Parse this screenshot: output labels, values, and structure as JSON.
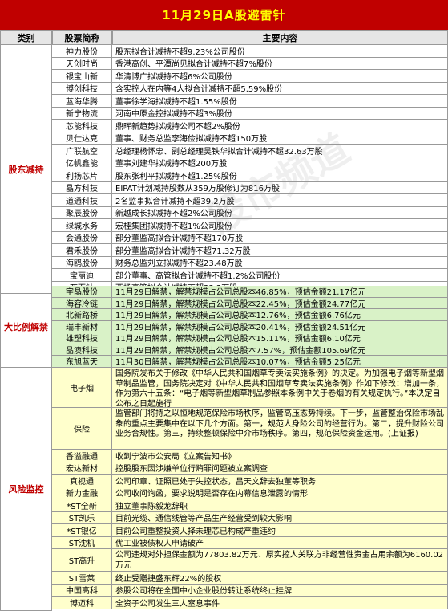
{
  "title": "11月29日A股避雷针",
  "headers": {
    "category": "类别",
    "stock": "股票简称",
    "content": "主要内容"
  },
  "watermark": "股市频道",
  "sections": [
    {
      "category": "股东减持",
      "rows": [
        {
          "name": "神力股份",
          "content": "股东拟合计减持不超9.23%公司股份"
        },
        {
          "name": "天创时尚",
          "content": "香港高创、平潭尚见拟合计减持不超7%股份"
        },
        {
          "name": "银宝山新",
          "content": "华清博广拟减持不超6%公司股份"
        },
        {
          "name": "博创科技",
          "content": "含实控人在内等4人拟合计减持不超5.59%股份"
        },
        {
          "name": "蓝海华腾",
          "content": "董事徐学海拟减持不超1.55%股份"
        },
        {
          "name": "新宁物流",
          "content": "河南中原金控拟减持不超3%股份"
        },
        {
          "name": "芯能科技",
          "content": "鼎晖新趋势拟减持公司不超2%股份"
        },
        {
          "name": "贝仕达克",
          "content": "董事、财务总监李海俭拟减持不超150万股"
        },
        {
          "name": "广联航空",
          "content": "总经理杨怀忠、副总经理吴铁华拟合计减持不超32.63万股"
        },
        {
          "name": "亿帆鑫能",
          "content": "董事刘建华拟减持不超200万股"
        },
        {
          "name": "利扬芯片",
          "content": "股东张利平拟减持不超1.25%股份"
        },
        {
          "name": "晶方科技",
          "content": "EIPAT计划减持股数从359万股修订为816万股"
        },
        {
          "name": "道通科技",
          "content": "2名监事拟合计减持不超39.2万股"
        },
        {
          "name": "聚辰股份",
          "content": "新越成长拟减持不超2%公司股份"
        },
        {
          "name": "绿城水务",
          "content": "宏桂集团拟减持不超1%公司股份"
        },
        {
          "name": "会通股份",
          "content": "部分董监高拟合计减持不超170万股"
        },
        {
          "name": "君禾股份",
          "content": "部分董监高拟合计减持不超71.32万股"
        },
        {
          "name": "海鸥股份",
          "content": "财务总监刘立拟减持不超23.48万股"
        },
        {
          "name": "宝丽迪",
          "content": "部分董事、高管拟合计减持不超1.2%公司股份"
        },
        {
          "name": "两面针",
          "content": "西场高管拟合计减持不超33.3万股"
        }
      ]
    },
    {
      "category": "大比例解禁",
      "rows": [
        {
          "name": "宇晶股份",
          "content": "11月29日解禁，解禁规模占公司总股本46.85%，预估金额21.17亿元"
        },
        {
          "name": "海容冷链",
          "content": "11月29日解禁，解禁规模占公司总股本22.45%，预估金额24.77亿元"
        },
        {
          "name": "北新路桥",
          "content": "11月29日解禁，解禁规模占公司总股本12.76%，预估金额6.76亿元"
        },
        {
          "name": "瑞丰新材",
          "content": "11月29日解禁，解禁规模占公司总股本20.41%，预估金额24.51亿元"
        },
        {
          "name": "雄塑科技",
          "content": "11月29日解禁，解禁规模占公司总股本15.11%，预估金额6.10亿元"
        },
        {
          "name": "晶澳科技",
          "content": "11月29日解禁，解禁规模占公司总股本7.57%，预估金额105.69亿元"
        },
        {
          "name": "东旭蓝天",
          "content": "11月30日解禁，解禁规模占公司总股本10.07%，预估金额5.25亿元"
        }
      ]
    },
    {
      "category": "风险监控",
      "rows": [
        {
          "name": "电子烟",
          "content": "国务院发布关于修改《中华人民共和国烟草专卖法实施条例》的决定。为加强电子烟等新型烟草制品监管，国务院决定对《中华人民共和国烟草专卖法实施条例》作如下修改：增加一条，作为第六十五条：“电子烟等新型烟草制品参照本条例中关于卷烟的有关规定执行。”本决定自公布之日起施行"
        },
        {
          "name": "保险",
          "content": "监管部门将持之以恒地规范保险市场秩序，监管高压态势持续。下一步，监管整治保险市场乱象的重点主要集中在以下几个方面。第一，规范人身险公司的经营行为。第二，提升财险公司业务合规性。第三，持续整顿保险中介市场秩序。第四，规范保险资金运用。(上证报)"
        },
        {
          "name": "香溢融通",
          "content": "收到宁波市公安局《立案告知书》"
        },
        {
          "name": "宏达新材",
          "content": "控股股东因涉嫌单位行贿罪问题被立案调查"
        },
        {
          "name": "真视通",
          "content": "公司印章、证照已处于失控状态，吕天文辞去独董等职务"
        },
        {
          "name": "新力金融",
          "content": "公司收问询函，要求说明是否存在内幕信息泄露的情形"
        },
        {
          "name": "*ST全新",
          "content": "独立董事陈毅龙辞职"
        },
        {
          "name": "ST凯乐",
          "content": "目前光缆、通信线管等产品生产经营受到较大影响"
        },
        {
          "name": "*ST银亿",
          "content": "目前公司重整投资人择未理芯已构成严重违约"
        },
        {
          "name": "ST沈机",
          "content": "优工业被债权人申请破产"
        },
        {
          "name": "ST高升",
          "content": "公司违规对外担保金额为77803.82万元、原实控人关联方非经营性资金占用余额为6160.02万元"
        },
        {
          "name": "ST雪莱",
          "content": "终止受赠捷盛东辉22%的股权"
        },
        {
          "name": "中国高科",
          "content": "参股公司将在全国中小企业股份转让系统终止挂牌"
        },
        {
          "name": "博迈科",
          "content": "全资子公司发生三人窒息事件"
        }
      ]
    }
  ]
}
